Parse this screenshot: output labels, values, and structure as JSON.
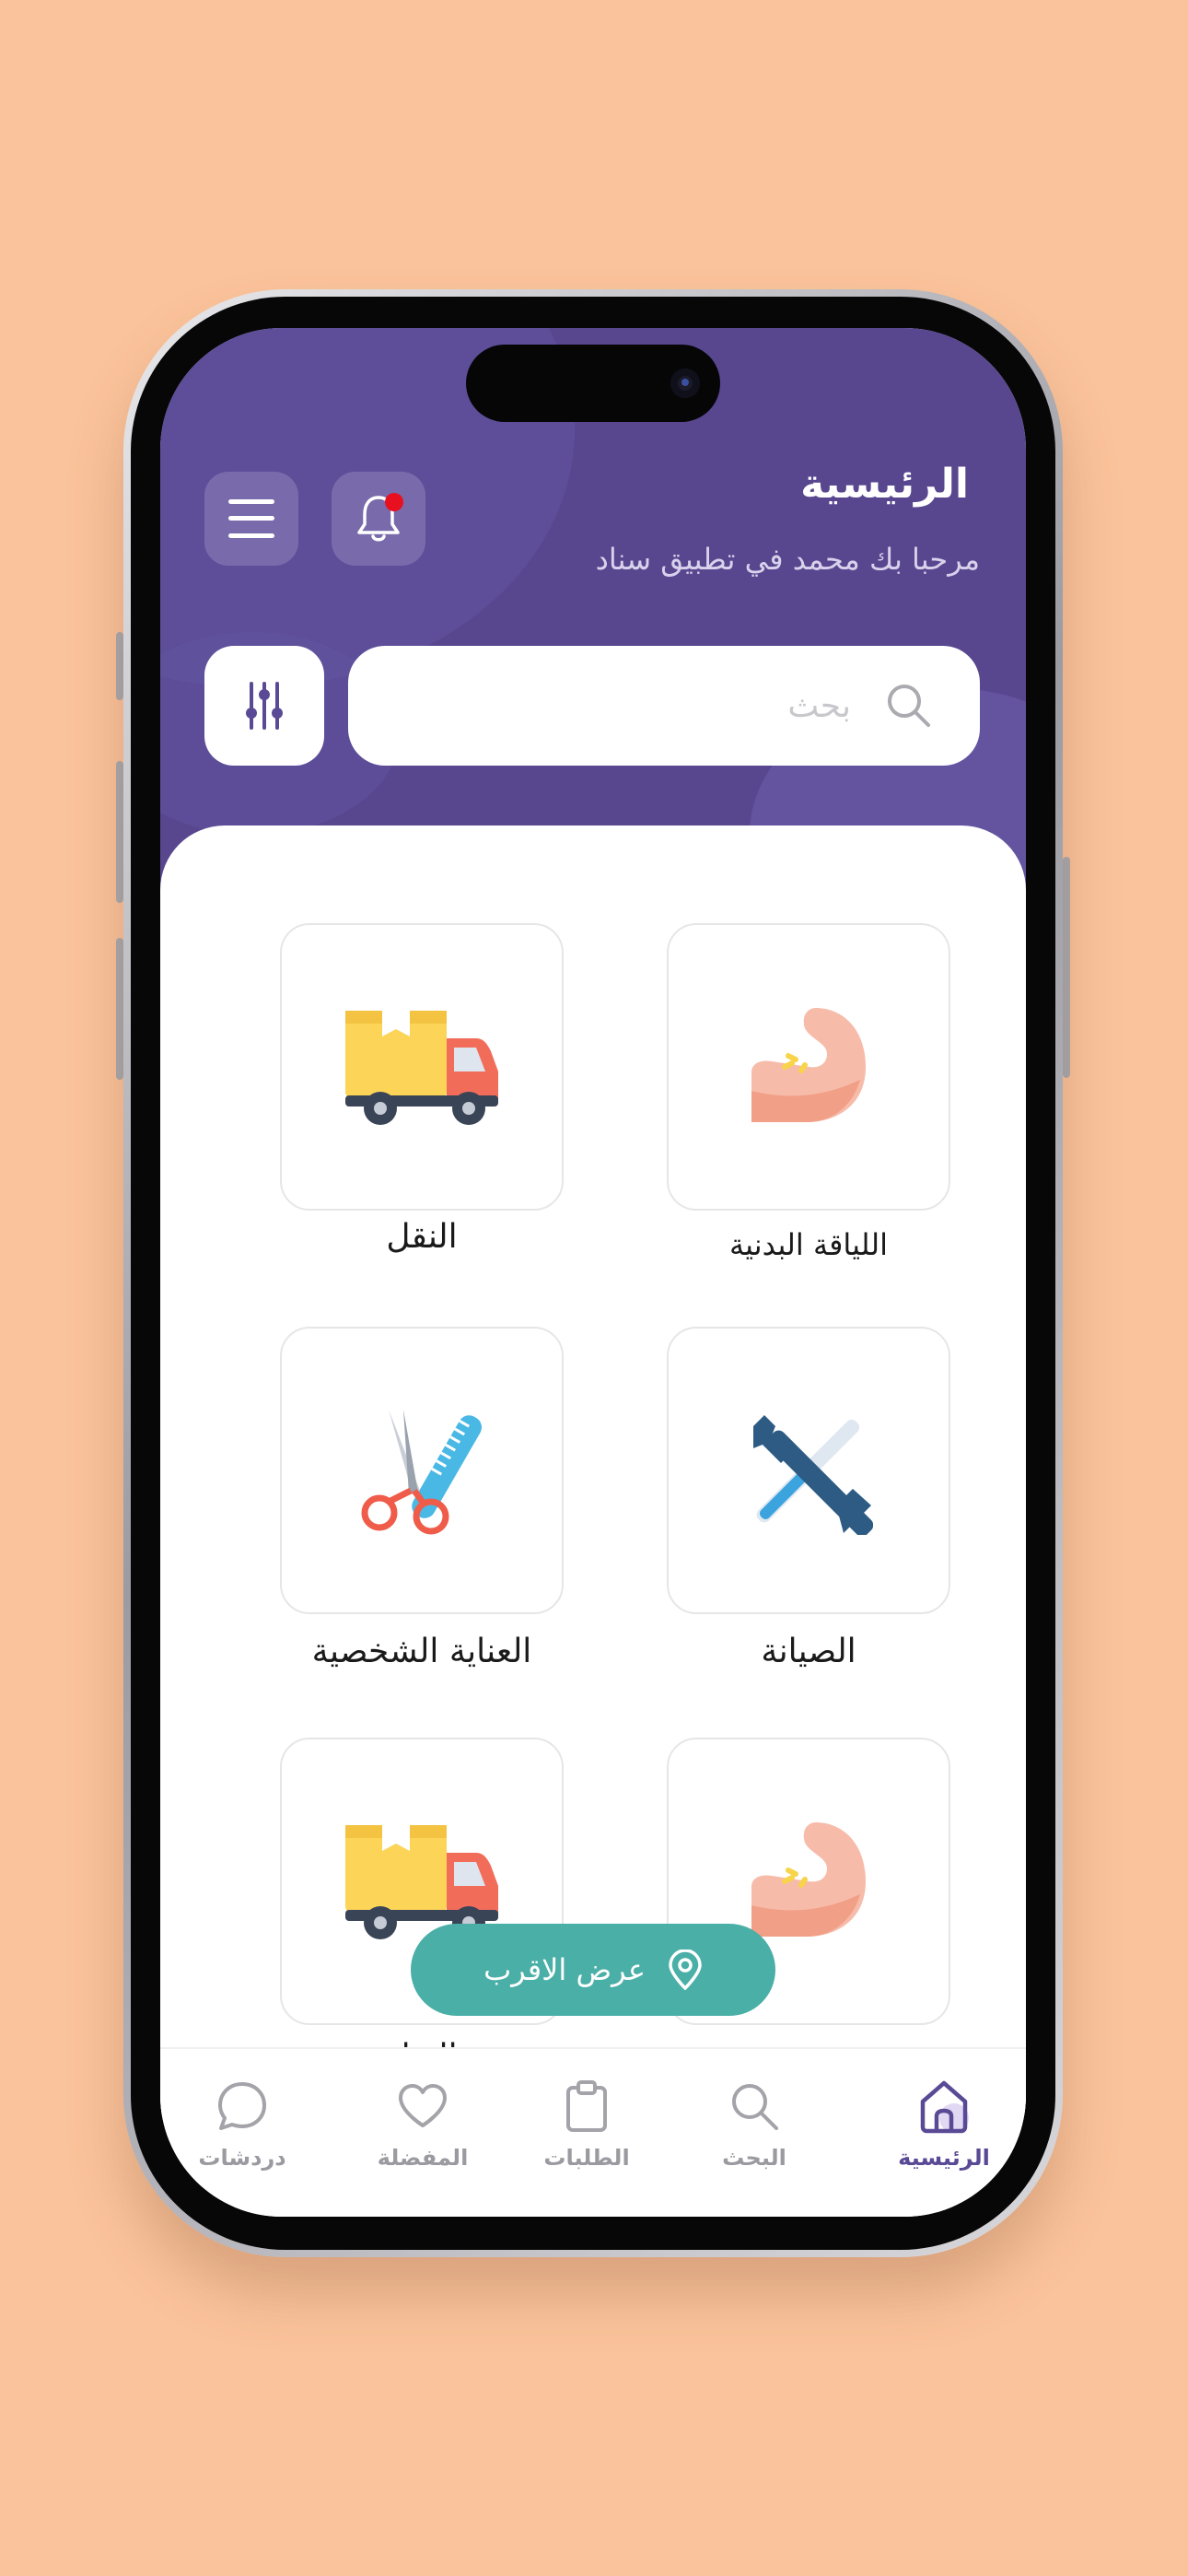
{
  "header": {
    "title": "الرئيسية",
    "subtitle": "مرحبا بك محمد في تطبيق سناد",
    "has_notification": true
  },
  "search": {
    "placeholder": "بحث",
    "value": ""
  },
  "categories": [
    {
      "label": "اللياقة البدنية",
      "icon": "muscle-arm-icon"
    },
    {
      "label": "النقل",
      "icon": "delivery-truck-icon"
    },
    {
      "label": "الصيانة",
      "icon": "wrench-screwdriver-icon"
    },
    {
      "label": "العناية الشخصية",
      "icon": "scissors-comb-icon"
    },
    {
      "label": "",
      "icon": "muscle-arm-icon"
    },
    {
      "label": "النقل",
      "icon": "delivery-truck-icon"
    }
  ],
  "nearby_button": {
    "label": "عرض الاقرب",
    "icon": "location-pin-icon"
  },
  "tabs": [
    {
      "label": "الرئيسية",
      "icon": "home-icon",
      "active": true
    },
    {
      "label": "البحث",
      "icon": "search-icon",
      "active": false
    },
    {
      "label": "الطلبات",
      "icon": "clipboard-icon",
      "active": false
    },
    {
      "label": "المفضلة",
      "icon": "heart-icon",
      "active": false
    },
    {
      "label": "دردشات",
      "icon": "chat-bubble-icon",
      "active": false
    }
  ],
  "colors": {
    "background": "#fbc39b",
    "header": "#58468f",
    "accent": "#5a4a96",
    "nearby_button": "#4aafa7",
    "notification_dot": "#e8101e"
  }
}
